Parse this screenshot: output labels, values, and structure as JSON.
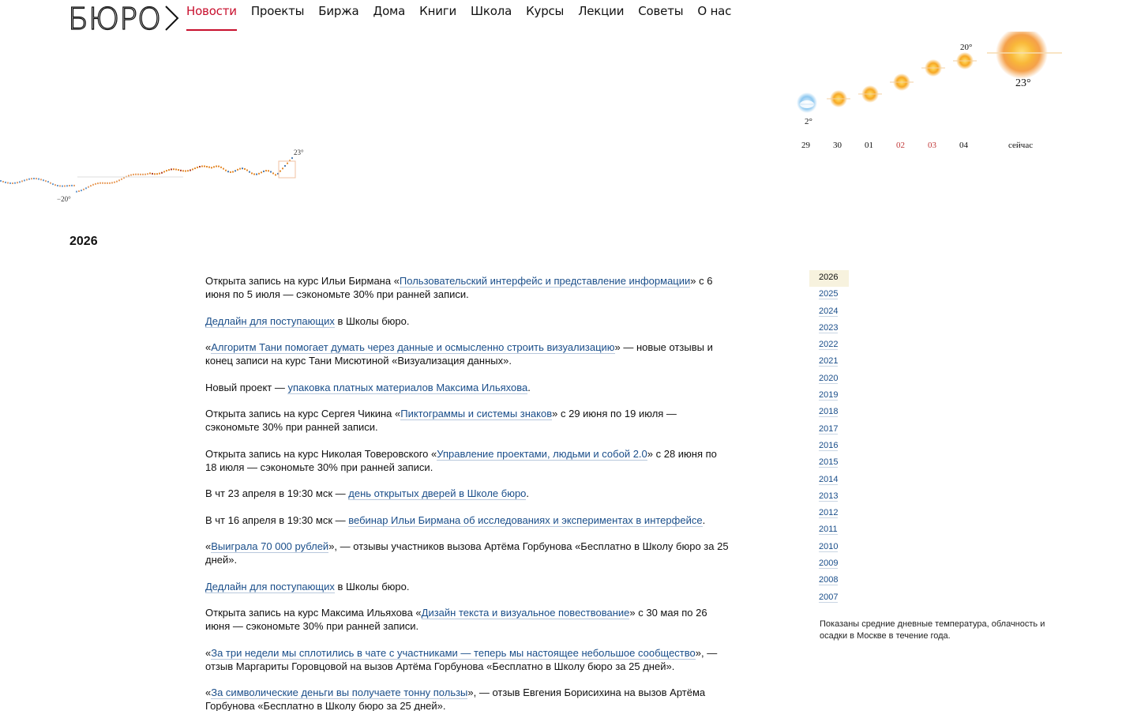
{
  "brand": {
    "logo_text": "БЮРО"
  },
  "nav": [
    {
      "label": "Новости",
      "active": true
    },
    {
      "label": "Проекты"
    },
    {
      "label": "Биржа"
    },
    {
      "label": "Дома"
    },
    {
      "label": "Книги"
    },
    {
      "label": "Школа"
    },
    {
      "label": "Курсы"
    },
    {
      "label": "Лекции"
    },
    {
      "label": "Советы"
    },
    {
      "label": "О нас"
    }
  ],
  "year_chart": {
    "min_label": "−20°",
    "max_label": "23°"
  },
  "weather": {
    "days": [
      {
        "label": "29",
        "temp": "2°",
        "icon": "snow-cloud-icon",
        "weekend": false
      },
      {
        "label": "30",
        "icon": "sun-icon",
        "weekend": false
      },
      {
        "label": "01",
        "icon": "sun-icon",
        "weekend": false
      },
      {
        "label": "02",
        "icon": "sun-icon",
        "weekend": true
      },
      {
        "label": "03",
        "icon": "sun-icon",
        "weekend": true
      },
      {
        "label": "04",
        "temp": "20°",
        "icon": "sun-icon",
        "weekend": false
      }
    ],
    "now": {
      "label": "сейчас",
      "temp": "23°",
      "icon": "big-sun-icon"
    },
    "colors": {
      "weekend": "#c23a3a",
      "accent": "#c8102e"
    }
  },
  "current_year": "2026",
  "news": [
    {
      "pre": "Открыта запись на курс Ильи Бирмана «",
      "link": "Пользовательский интерфейс и представление информации",
      "post": "» с 6 июня по 5 июля — сэкономьте 30% при ранней записи."
    },
    {
      "pre": "",
      "link": "Дедлайн для поступающих",
      "post": " в Школы бюро."
    },
    {
      "pre": "«",
      "link": "Алгоритм Тани помогает думать через данные и осмысленно строить визуализацию",
      "post": "» — новые отзывы и конец записи на курс Тани Мисютиной «Визуализация данных»."
    },
    {
      "pre": "Новый проект — ",
      "link": "упаковка платных материалов Максима Ильяхова",
      "post": "."
    },
    {
      "pre": "Открыта запись на курс Сергея Чикина «",
      "link": "Пиктограммы и системы знаков",
      "post": "» с 29 июня по 19 июля — сэкономьте 30% при ранней записи."
    },
    {
      "pre": "Открыта запись на курс Николая Товеровского «",
      "link": "Управление проектами, людьми и собой 2.0",
      "post": "» с 28 июня по 18 июля — сэкономьте 30% при ранней записи."
    },
    {
      "pre": "В чт 23 апреля в 19:30 мск — ",
      "link": "день открытых дверей в Школе бюро",
      "post": "."
    },
    {
      "pre": "В чт 16 апреля в 19:30 мск — ",
      "link": "вебинар Ильи Бирмана об исследованиях и экспериментах в интерфейсе",
      "post": "."
    },
    {
      "pre": "«",
      "link": "Выиграла 70 000 рублей",
      "post": "», — отзывы участников вызова Артёма Горбунова «Бесплатно в Школу бюро за 25 дней»."
    },
    {
      "pre": "",
      "link": "Дедлайн для поступающих",
      "post": " в Школы бюро."
    },
    {
      "pre": "Открыта запись на курс Максима Ильяхова «",
      "link": "Дизайн текста и визуальное повествование",
      "post": "» с 30 мая по 26 июня — сэкономьте 30% при ранней записи."
    },
    {
      "pre": "«",
      "link": "За три недели мы сплотились в чате с участниками — теперь мы настоящее небольшое сообщество",
      "post": "», — отзыв Маргариты Горовцовой на вызов Артёма Горбунова «Бесплатно в Школу бюро за 25 дней»."
    },
    {
      "pre": "«",
      "link": "За символические деньги вы получаете тонну пользы",
      "post": "», — отзыв Евгения Борисихина на вызов Артёма Горбунова «Бесплатно в Школу бюро за 25 дней»."
    }
  ],
  "years": [
    "2026",
    "2025",
    "2024",
    "2023",
    "2022",
    "2021",
    "2020",
    "2019",
    "2018",
    "2017",
    "2016",
    "2015",
    "2014",
    "2013",
    "2012",
    "2011",
    "2010",
    "2009",
    "2008",
    "2007"
  ],
  "note": "Показаны средние дневные температура, облачность и осадки в Москве в течение года."
}
